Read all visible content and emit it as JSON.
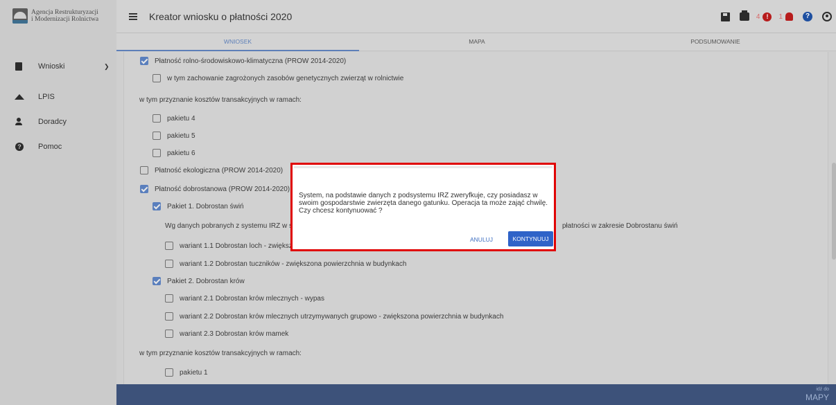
{
  "header": {
    "logo_line1": "Agencja Restrukturyzacji",
    "logo_line2": "i Modernizacji Rolnictwa",
    "title": "Kreator wniosku o płatności 2020",
    "count_alerts": "4",
    "count_notifications": "1",
    "icons": [
      "save-icon",
      "print-icon",
      "alert-icon",
      "bell-icon",
      "help-icon",
      "user-icon"
    ]
  },
  "sidebar": {
    "items": [
      {
        "label": "Wnioski",
        "icon": "document-icon",
        "expandable": true
      },
      {
        "label": "LPIS",
        "icon": "map-terrain-icon"
      },
      {
        "label": "Doradcy",
        "icon": "person-icon"
      },
      {
        "label": "Pomoc",
        "icon": "help-icon"
      }
    ]
  },
  "tabs": [
    {
      "label": "WNIOSEK",
      "active": true
    },
    {
      "label": "MAPA",
      "active": false
    },
    {
      "label": "PODSUMOWANIE",
      "active": false
    }
  ],
  "form": {
    "rows": [
      {
        "text": "Płatność rolno-środowiskowo-klimatyczna (PROW 2014-2020)",
        "checkbox": true,
        "checked": true
      },
      {
        "text": "w tym zachowanie zagrożonych zasobów genetycznych zwierząt w rolnictwie",
        "checkbox": true,
        "checked": false
      },
      {
        "text": "w tym przyznanie kosztów transakcyjnych w ramach:",
        "checkbox": false
      },
      {
        "text": "pakietu 4",
        "checkbox": true,
        "checked": false
      },
      {
        "text": "pakietu 5",
        "checkbox": true,
        "checked": false
      },
      {
        "text": "pakietu 6",
        "checkbox": true,
        "checked": false
      },
      {
        "text": "Płatność ekologiczna (PROW 2014-2020)",
        "checkbox": true,
        "checked": false
      },
      {
        "text": "Płatność dobrostanowa (PROW 2014-2020)",
        "checkbox": true,
        "checked": true
      },
      {
        "text": "Pakiet 1. Dobrostan świń",
        "checkbox": true,
        "checked": true
      },
      {
        "text": "Wg danych pobranych z systemu IRZ w sw",
        "checkbox": false
      },
      {
        "text": "płatności w zakresie Dobrostanu świń",
        "checkbox": false
      },
      {
        "text": "wariant 1.1 Dobrostan loch - zwiększ",
        "checkbox": true,
        "checked": false
      },
      {
        "text": "wariant 1.2 Dobrostan tuczników - zwiększona powierzchnia w budynkach",
        "checkbox": true,
        "checked": false
      },
      {
        "text": "Pakiet 2. Dobrostan krów",
        "checkbox": true,
        "checked": true
      },
      {
        "text": "wariant 2.1 Dobrostan krów mlecznych - wypas",
        "checkbox": true,
        "checked": false
      },
      {
        "text": "wariant 2.2 Dobrostan krów mlecznych utrzymywanych grupowo - zwiększona powierzchnia w budynkach",
        "checkbox": true,
        "checked": false
      },
      {
        "text": "wariant 2.3 Dobrostan krów mamek",
        "checkbox": true,
        "checked": false
      },
      {
        "text": "w tym przyznanie kosztów transakcyjnych w ramach:",
        "checkbox": false
      },
      {
        "text": "pakietu 1",
        "checkbox": true,
        "checked": false
      }
    ]
  },
  "footer": {
    "small": "idź do",
    "big": "MAPY"
  },
  "dialog": {
    "message": "System, na podstawie danych z podsystemu IRZ zweryfkuje, czy posiadasz w swoim gospodarstwie zwierzęta danego gatunku. Operacja ta może zająć chwilę. Czy chcesz kontynuować ?",
    "cancel_label": "ANULUJ",
    "ok_label": "KONTYNUUJ",
    "highlight_color": "#e00000",
    "accent_color": "#2f63c8"
  }
}
